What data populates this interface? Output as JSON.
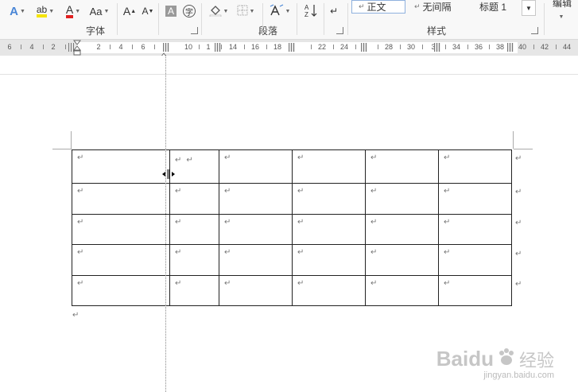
{
  "ribbon": {
    "font_group": {
      "label": "字体",
      "change_case": "Aa",
      "grow_font": "A",
      "shrink_font": "A",
      "char_shading": "A",
      "enclose": "字",
      "highlight": "ab",
      "font_color": "A"
    },
    "paragraph_group": {
      "label": "段落"
    },
    "styles_group": {
      "label": "样式",
      "items": [
        "正文",
        "无间隔",
        "标题 1"
      ]
    },
    "editing_label": "编辑",
    "sort_label": "A↓Z"
  },
  "ruler": {
    "labels": [
      "6",
      "4",
      "2",
      "2",
      "4",
      "6",
      "10",
      "1",
      "14",
      "16",
      "18",
      "22",
      "24",
      "28",
      "30",
      "3",
      "34",
      "36",
      "38",
      "40",
      "42",
      "44"
    ]
  },
  "document": {
    "paragraph_mark": "↵",
    "rows": 5,
    "cols": 6
  },
  "colors": {
    "highlight_yellow": "#f5e400",
    "font_red": "#e02020",
    "text_effect_blue": "#4a86d6",
    "table_border": "#222222"
  },
  "watermark": {
    "brand": "Baidu",
    "sub": "经验",
    "url": "jingyan.baidu.com"
  }
}
